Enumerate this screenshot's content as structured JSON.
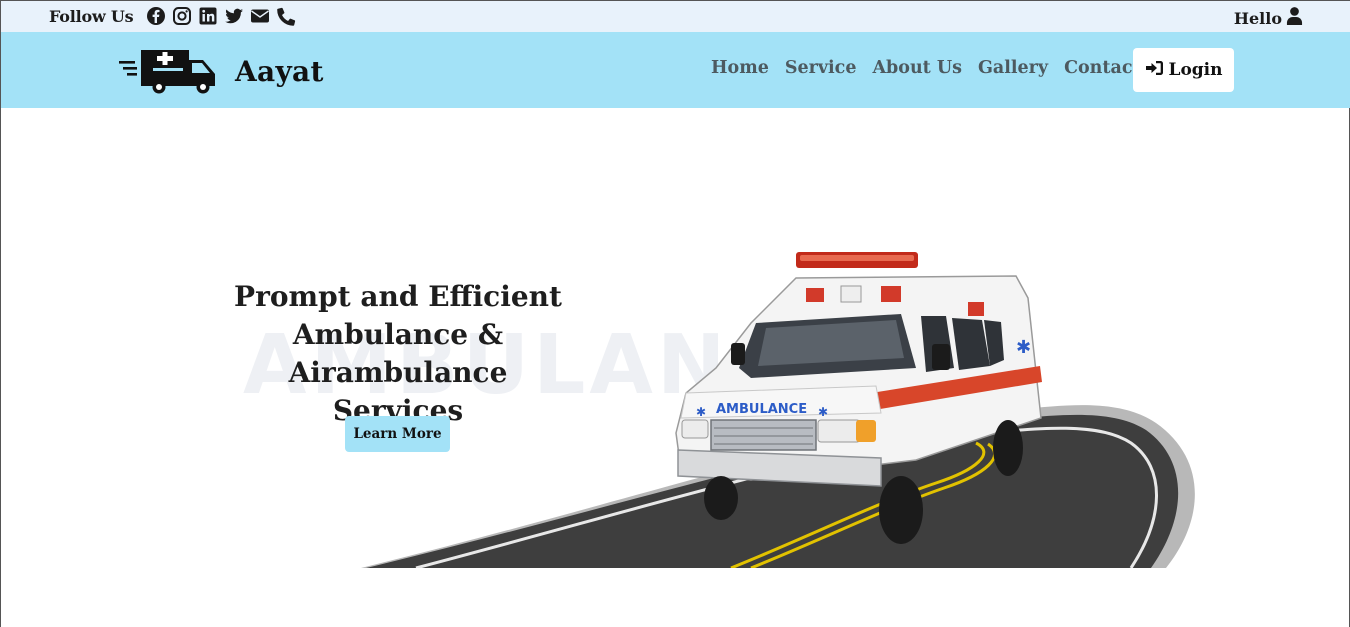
{
  "topbar": {
    "follow_label": "Follow Us",
    "social_icons": [
      "facebook-icon",
      "instagram-icon",
      "linkedin-icon",
      "twitter-icon",
      "envelope-icon",
      "phone-icon"
    ],
    "hello_label": "Hello"
  },
  "navbar": {
    "brand_name": "Aayat",
    "links": [
      "Home",
      "Service",
      "About Us",
      "Gallery",
      "Contact"
    ],
    "login_label": "Login"
  },
  "hero": {
    "headline_line1": "Prompt and Efficient",
    "headline_line2": "Ambulance & Airambulance",
    "headline_line3": "Services",
    "watermark": "AMBULANCE",
    "learn_more_label": "Learn More",
    "vehicle_text": "AMBULANCE"
  },
  "colors": {
    "topbar_bg": "#e8f2fb",
    "navbar_bg": "#a3e2f7",
    "button_accent": "#a3e2f7",
    "nav_link": "#4d5a60"
  }
}
